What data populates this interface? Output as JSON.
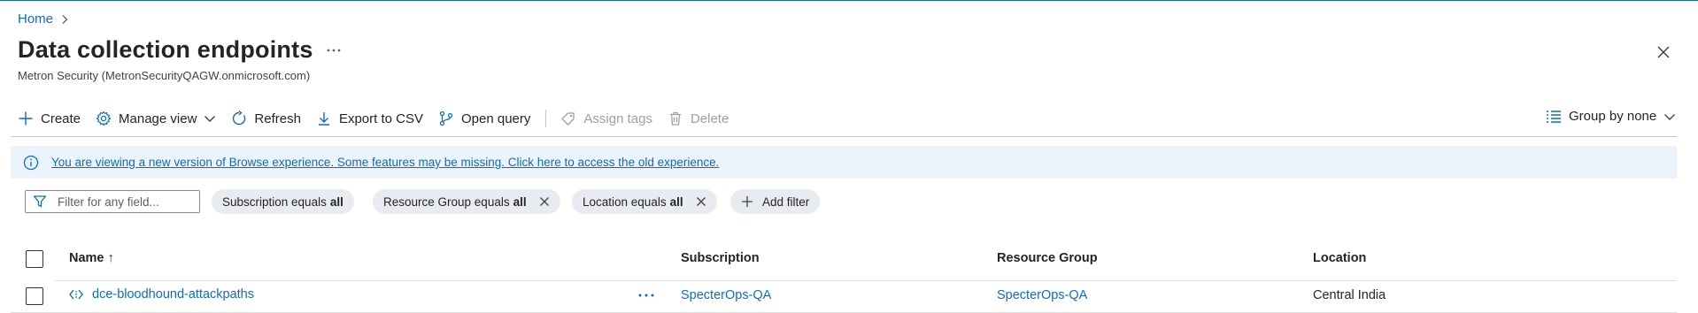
{
  "breadcrumb": {
    "home": "Home"
  },
  "page": {
    "title": "Data collection endpoints",
    "subtitle": "Metron Security (MetronSecurityQAGW.onmicrosoft.com)"
  },
  "toolbar": {
    "create": "Create",
    "manage_view": "Manage view",
    "refresh": "Refresh",
    "export_csv": "Export to CSV",
    "open_query": "Open query",
    "assign_tags": "Assign tags",
    "delete": "Delete",
    "group_by": "Group by none"
  },
  "banner": {
    "text": "You are viewing a new version of Browse experience. Some features may be missing. Click here to access the old experience."
  },
  "filters": {
    "search_placeholder": "Filter for any field...",
    "pills": [
      {
        "label": "Subscription equals",
        "value": "all"
      },
      {
        "label": "Resource Group equals",
        "value": "all"
      },
      {
        "label": "Location equals",
        "value": "all"
      }
    ],
    "add_filter": "Add filter"
  },
  "table": {
    "columns": {
      "name": "Name ↑",
      "subscription": "Subscription",
      "resource_group": "Resource Group",
      "location": "Location"
    },
    "rows": [
      {
        "name": "dce-bloodhound-attackpaths",
        "subscription": "SpecterOps-QA",
        "resource_group": "SpecterOps-QA",
        "location": "Central India"
      }
    ]
  },
  "colors": {
    "accent": "#0f6cbd",
    "banner_bg": "#ebf3fc",
    "pill_bg": "#e8ecf1"
  }
}
